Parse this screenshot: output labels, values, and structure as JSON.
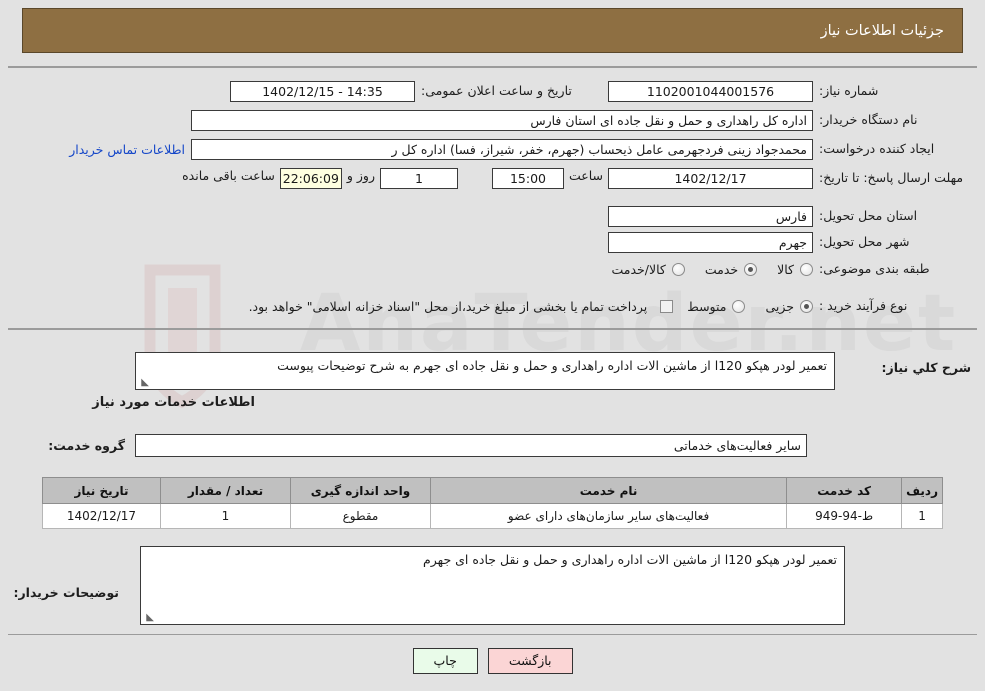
{
  "header": {
    "title": "جزئیات اطلاعات نیاز"
  },
  "fields": {
    "need_number_label": "شماره نیاز:",
    "need_number_value": "1102001044001576",
    "announce_label": "تاریخ و ساعت اعلان عمومی:",
    "announce_value": "14:35 - 1402/12/15",
    "buyer_org_label": "نام دستگاه خریدار:",
    "buyer_org_value": "اداره کل راهداری و حمل و نقل جاده ای استان فارس",
    "creator_label": "ایجاد کننده درخواست:",
    "creator_value": "محمدجواد زینی فردجهرمی عامل ذیحساب (جهرم، خفر، شیراز، فسا) اداره کل ر",
    "contact_link": "اطلاعات تماس خریدار",
    "deadline_label": "مهلت ارسال پاسخ: تا تاریخ:",
    "deadline_date": "1402/12/17",
    "deadline_hour_label": "ساعت",
    "deadline_hour": "15:00",
    "days_value": "1",
    "days_label": "روز و",
    "countdown": "22:06:09",
    "remaining_label": "ساعت باقی مانده",
    "province_label": "استان محل تحویل:",
    "province_value": "فارس",
    "city_label": "شهر محل تحویل:",
    "city_value": "جهرم",
    "category_label": "طبقه بندی موضوعی:",
    "process_label": "نوع فرآیند خرید :",
    "treasury_note": "پرداخت تمام یا بخشی از مبلغ خرید،از محل \"اسناد خزانه اسلامی\" خواهد بود."
  },
  "category_options": [
    {
      "label": "کالا",
      "selected": false
    },
    {
      "label": "خدمت",
      "selected": true
    },
    {
      "label": "کالا/خدمت",
      "selected": false
    }
  ],
  "process_options": [
    {
      "label": "جزیی",
      "selected": true
    },
    {
      "label": "متوسط",
      "selected": false
    }
  ],
  "description": {
    "label": "شرح کلي نياز:",
    "value": "تعمیر لودر هپکو l120 از ماشین الات اداره راهداری و حمل و نقل جاده ای جهرم به شرح توضیحات پیوست"
  },
  "services_section": {
    "heading": "اطلاعات خدمات مورد نیاز",
    "group_label": "گروه خدمت:",
    "group_value": "سایر فعالیت‌های خدماتی"
  },
  "table": {
    "columns": [
      "ردیف",
      "کد خدمت",
      "نام خدمت",
      "واحد اندازه گیری",
      "تعداد / مقدار",
      "تاریخ نیاز"
    ],
    "rows": [
      {
        "row": "1",
        "code": "ط-94-949",
        "name": "فعالیت‌های سایر سازمان‌های دارای عضو",
        "unit": "مقطوع",
        "qty": "1",
        "date": "1402/12/17"
      }
    ]
  },
  "buyer_notes": {
    "label": "توضیحات خریدار:",
    "value": "تعمیر لودر هپکو l120 از ماشین الات اداره راهداری و حمل و نقل جاده ای جهرم"
  },
  "buttons": {
    "print": "چاپ",
    "back": "بازگشت"
  },
  "colors": {
    "header_brown": "#8e6f42",
    "page_bg": "#e2e2e2",
    "link_blue": "#1446c8",
    "countdown_bg": "#feffe0",
    "table_header_bg": "#c0c0c0",
    "print_btn_bg": "#e9fbe9",
    "back_btn_bg": "#fbd5d5"
  },
  "watermark": {
    "text": "AnaTender.net"
  }
}
